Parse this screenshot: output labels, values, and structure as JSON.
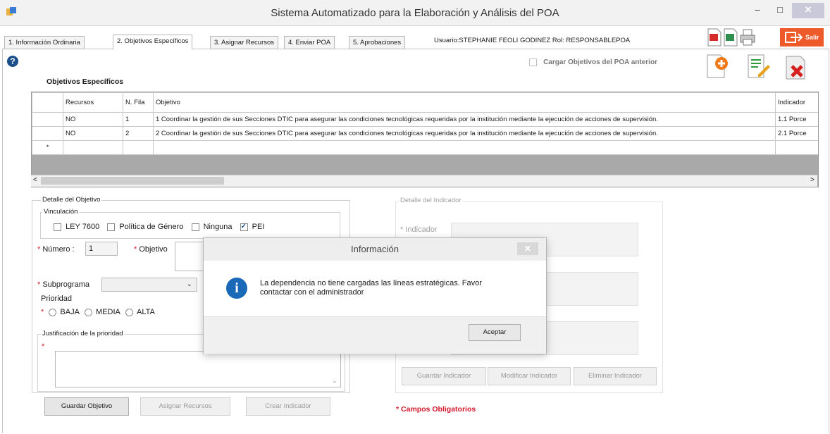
{
  "window": {
    "title": "Sistema Automatizado para la Elaboración y Análisis del POA",
    "minimize_glyph": "–",
    "maximize_glyph": "□",
    "close_glyph": "✕"
  },
  "tabs": [
    {
      "label": "1. Información Ordinaria"
    },
    {
      "label": "2. Objetivos Específicos"
    },
    {
      "label": "3. Asignar Recursos"
    },
    {
      "label": "4. Enviar POA"
    },
    {
      "label": "5. Aprobaciones"
    }
  ],
  "user_info": "Usuario:STEPHANIE FEOLI GODINEZ  Rol: RESPONSABLEPOA",
  "salir_label": "Salir",
  "help_glyph": "?",
  "load_previous_label": "Cargar Objetivos del POA anterior",
  "section_title": "Objetivos Específicos",
  "grid": {
    "columns": [
      "Recursos",
      "N. Fila",
      "Objetivo",
      "Indicador"
    ],
    "rows": [
      {
        "recursos": "NO",
        "fila": "1",
        "objetivo": "1 Coordinar la gestión de sus Secciones DTIC para asegurar las condiciones tecnológicas requeridas por la institución mediante  la ejecución de acciones de supervisión.",
        "indicador": "1.1 Porce"
      },
      {
        "recursos": "NO",
        "fila": "2",
        "objetivo": "2 Coordinar la gestión de sus Secciones DTIC para asegurar las condiciones tecnológicas requeridas por la institución mediante  la ejecución de acciones de supervisión.",
        "indicador": "2.1 Porce"
      }
    ],
    "new_row_marker": "*",
    "scroll_left": "<",
    "scroll_right": ">"
  },
  "detalle_objetivo": {
    "legend": "Detalle del Objetivo",
    "vinculacion_legend": "Vinculación",
    "vinculaciones": [
      {
        "label": "LEY 7600",
        "checked": false
      },
      {
        "label": "Política de Género",
        "checked": false
      },
      {
        "label": "Ninguna",
        "checked": false
      },
      {
        "label": "PEI",
        "checked": true
      }
    ],
    "numero_label": "Número :",
    "numero_value": "1",
    "objetivo_label": "Objetivo",
    "subprograma_label": "Subprograma",
    "prioridad_legend": "Prioridad",
    "prioridades": [
      "BAJA",
      "MEDIA",
      "ALTA"
    ],
    "justificacion_legend": "Justificación de la prioridad",
    "required_mark": "*"
  },
  "buttons": {
    "guardar_objetivo": "Guardar Objetivo",
    "asignar_recursos": "Asignar Recursos",
    "crear_indicador": "Crear Indicador",
    "guardar_indicador": "Guardar Indicador",
    "modificar_indicador": "Modificar Indicador",
    "eliminar_indicador": "Eliminar Indicador"
  },
  "detalle_indicador": {
    "legend": "Detalle del Indicador",
    "indicador_label": "Indicador"
  },
  "campos_obligatorios": "Campos Obligatorios",
  "dialog": {
    "title": "Información",
    "close_glyph": "✕",
    "message": "La dependencia no tiene cargadas las  líneas estratégicas. Favor contactar con el administrador",
    "icon_glyph": "i",
    "accept_label": "Aceptar"
  }
}
